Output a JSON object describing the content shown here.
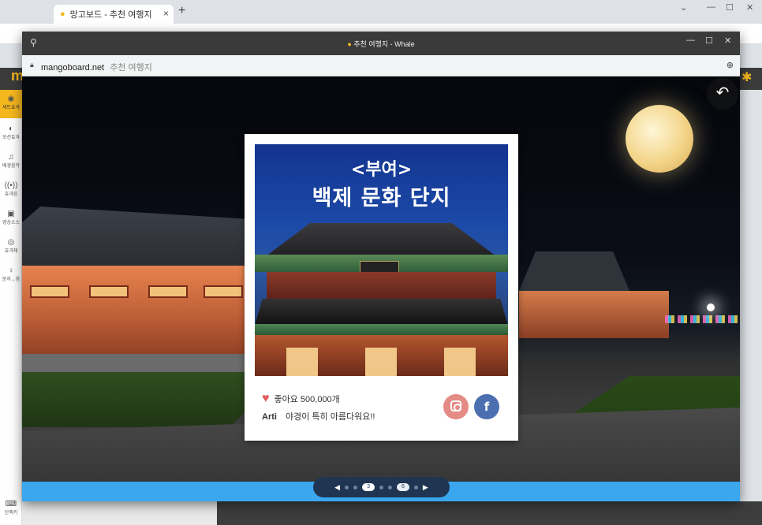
{
  "browser": {
    "tab_title": "망고보드 - 추천 여행지",
    "tab_close": "×",
    "new_tab": "+",
    "min": "—",
    "max": "☐",
    "close": "✕"
  },
  "app": {
    "logo": "m",
    "left_menu": [
      {
        "label": "세트효과"
      },
      {
        "label": "모션효과"
      },
      {
        "label": "배경음악"
      },
      {
        "label": "효과음"
      },
      {
        "label": "영상소스"
      },
      {
        "label": "효과체"
      },
      {
        "label": "문자→음"
      }
    ],
    "shortcut_label": "단축키"
  },
  "popup": {
    "title": "추천 여행지 - Whale",
    "domain": "mangoboard.net",
    "page_title": "추천 여행지"
  },
  "card": {
    "headline_1": "<부여>",
    "headline_2": "백제 문화 단지",
    "likes": "좋아요 500,000개",
    "commenter": "Arti",
    "comment": "야경이 특히 아름다워요!!",
    "instagram_label": "",
    "facebook_label": "f"
  },
  "pager": {
    "prev": "◀",
    "next": "▶",
    "current_page": "3",
    "total_pages": "6"
  },
  "colors": {
    "accent": "#f5b71e",
    "blue_bar": "#3aa7ef",
    "pager_bg": "#1f3552",
    "instagram": "#e58b86",
    "facebook": "#4b6fb0",
    "heart": "#e05a5a"
  }
}
